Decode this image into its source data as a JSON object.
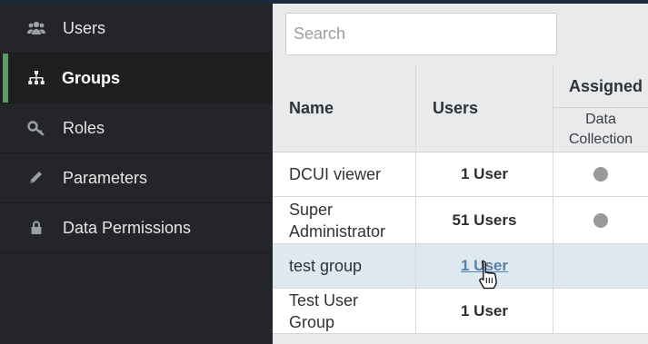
{
  "sidebar": {
    "items": [
      {
        "label": "Users",
        "icon": "users-icon",
        "active": false
      },
      {
        "label": "Groups",
        "icon": "groups-icon",
        "active": true
      },
      {
        "label": "Roles",
        "icon": "key-icon",
        "active": false
      },
      {
        "label": "Parameters",
        "icon": "pencil-icon",
        "active": false
      },
      {
        "label": "Data Permissions",
        "icon": "lock-icon",
        "active": false
      }
    ],
    "accent_color": "#5a9e63"
  },
  "search": {
    "placeholder": "Search",
    "value": ""
  },
  "table": {
    "headers": {
      "name": "Name",
      "users": "Users",
      "assigned": "Assigned",
      "assigned_sub": [
        "Data",
        "Collection"
      ]
    },
    "rows": [
      {
        "name": [
          "DCUI viewer"
        ],
        "users": "1 User",
        "data_collection": true,
        "hover": false
      },
      {
        "name": [
          "Super",
          "Administrator"
        ],
        "users": "51 Users",
        "data_collection": true,
        "hover": false
      },
      {
        "name": [
          "test group"
        ],
        "users": "1 User",
        "data_collection": false,
        "hover": true
      },
      {
        "name": [
          "Test User",
          "Group"
        ],
        "users": "1 User",
        "data_collection": false,
        "hover": false
      }
    ]
  }
}
